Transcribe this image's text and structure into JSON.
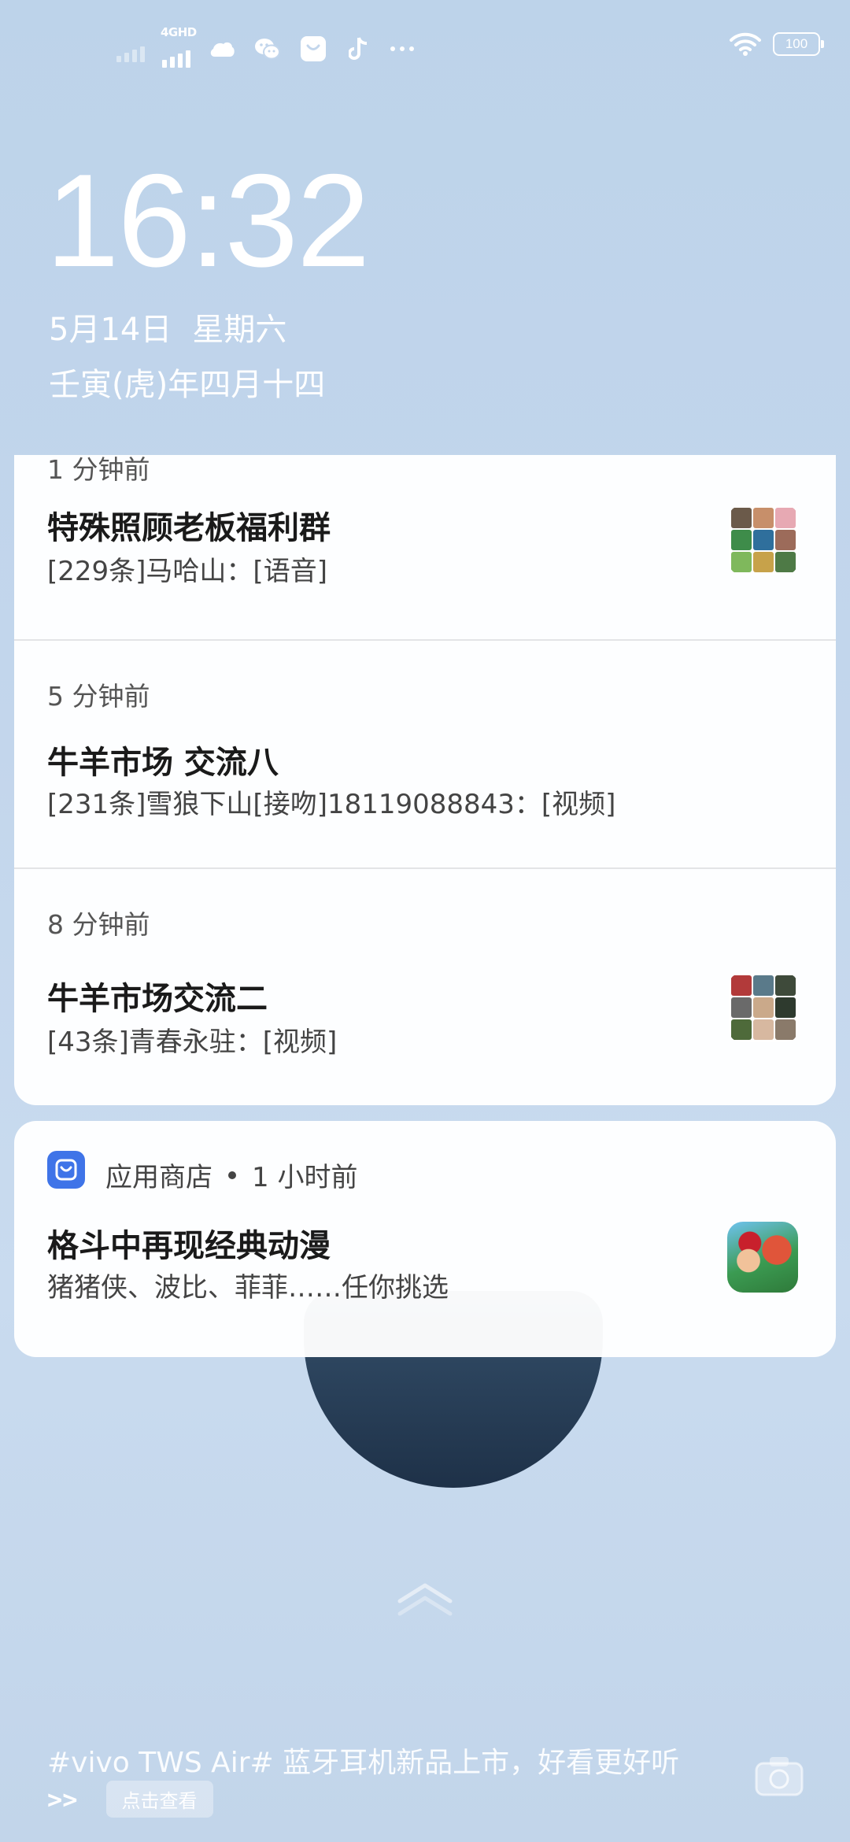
{
  "status_bar": {
    "network_label": "4GHD",
    "battery": "100",
    "icons": [
      "signal-weak-icon",
      "signal-4g-icon",
      "weibo-icon",
      "wechat-icon",
      "app-store-icon",
      "tiktok-icon",
      "more-icon",
      "wifi-icon",
      "battery-icon"
    ]
  },
  "lock_screen": {
    "time": "16:32",
    "date": "5月14日",
    "weekday": "星期六",
    "lunar_date": "壬寅(虎)年四月十四"
  },
  "notifications": {
    "partial_time": "1 分钟前",
    "items": [
      {
        "title": "特殊照顾老板福利群",
        "body": "[229条]马哈山：[语音]",
        "has_thumb": true
      },
      {
        "time": "5 分钟前",
        "title": "牛羊市场  交流八",
        "body": "[231条]雪狼下山[接吻]18119088843：[视频]",
        "has_thumb": false
      },
      {
        "time": "8 分钟前",
        "title": "牛羊市场交流二",
        "body": "[43条]青春永驻：[视频]",
        "has_thumb": true
      }
    ],
    "app_store": {
      "app_name": "应用商店",
      "time": "1 小时前",
      "title": "格斗中再现经典动漫",
      "body": "猪猪侠、波比、菲菲……任你挑选"
    }
  },
  "promo": {
    "text": "#vivo  TWS  Air#  蓝牙耳机新品上市，好看更好听",
    "arrow": ">>",
    "button": "点击查看"
  },
  "colors": {
    "background": "#c3d6ec",
    "app_store_accent": "#3f74e8",
    "card": "#ffffff"
  }
}
